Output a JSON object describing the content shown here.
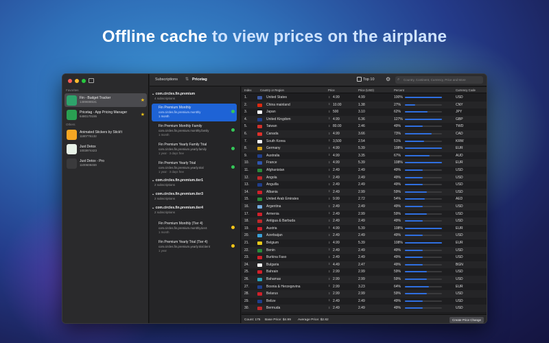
{
  "headline": {
    "part1": "Offline cache",
    "part2": " to view prices on the airplane"
  },
  "sidebar": {
    "favorites_label": "Favorites",
    "others_label": "Others",
    "favorites": [
      {
        "name": "Fin - Budget Tracker",
        "id": "1489698531",
        "icon_color": "#2ea36b"
      },
      {
        "name": "Pricetag - App Pricing Manager",
        "id": "6480170155",
        "icon_color": "#2aa052"
      }
    ],
    "others": [
      {
        "name": "Animated Stickers by Stick!t",
        "id": "1180776132",
        "icon_color": "#f5a623"
      },
      {
        "name": "Just Detox",
        "id": "1003974423",
        "icon_color": "#e8f3e8"
      },
      {
        "name": "Just Detox - Pro",
        "id": "1100608459",
        "icon_color": "#3a3a3c"
      }
    ]
  },
  "toolbar": {
    "subscriptions_label": "Subscriptions",
    "title": "Pricetag",
    "top_label": "Top 10",
    "search_placeholder": "Country, Continent, Currency, Price and More"
  },
  "groups": [
    {
      "title": "com.circles.fin.premium",
      "count": "4 subscriptions"
    },
    {
      "title": "com.circles.fin.premium.tier1",
      "count": "2 subscriptions"
    },
    {
      "title": "com.circles.fin.premium.tier3",
      "count": "2 subscriptions"
    },
    {
      "title": "com.circles.fin.premium.tier4",
      "count": "2 subscriptions"
    }
  ],
  "subscriptions": [
    {
      "name": "Fin Premium Monthly",
      "id": "com.circles.fin.premium.monthly",
      "period": "1 month",
      "status": "#34c759"
    },
    {
      "name": "Fin Premium Monthly Family",
      "id": "com.circles.fin.premium.monthly.family",
      "period": "1 month",
      "status": "#34c759"
    },
    {
      "name": "Fin Premium Yearly Family Trial",
      "id": "com.circles.fin.premium.yearly.family",
      "period": "1 year · 3 days free",
      "status": "#34c759"
    },
    {
      "name": "Fin Premium Yearly Trial",
      "id": "com.circles.fin.premium.yearly.trial",
      "period": "1 year · 3 days free",
      "status": "#34c759"
    },
    {
      "name": "Fin Premium Monthly (Tier 4)",
      "id": "com.circles.fin.premium.monthly.tier4",
      "period": "1 month",
      "status": "#f5c518"
    },
    {
      "name": "Fin Premium Yearly Trial (Tier 4)",
      "id": "com.circles.fin.premium.yearly.trial.tier4",
      "period": "1 year",
      "status": "#f5c518"
    }
  ],
  "table": {
    "headers": {
      "index": "Index",
      "country": "Country or Region",
      "price": "Price",
      "price_usd": "Price (USD)",
      "percent": "Percent",
      "currency": "Currency Code"
    },
    "rows": [
      {
        "i": "1.",
        "country": "United States",
        "price": "4.99",
        "usd": "4.99",
        "pct": "100%",
        "cur": "USD",
        "flag": "#3c5aa6"
      },
      {
        "i": "2.",
        "country": "China mainland",
        "price": "10.00",
        "usd": "1.38",
        "pct": "27%",
        "cur": "CNY",
        "flag": "#de2910"
      },
      {
        "i": "3.",
        "country": "Japan",
        "price": "500",
        "usd": "3.10",
        "pct": "62%",
        "cur": "JPY",
        "flag": "#ffffff"
      },
      {
        "i": "4.",
        "country": "United Kingdom",
        "price": "4.99",
        "usd": "6.36",
        "pct": "127%",
        "cur": "GBP",
        "flag": "#1f3e8c"
      },
      {
        "i": "5.",
        "country": "Taiwan",
        "price": "80.00",
        "usd": "2.46",
        "pct": "49%",
        "cur": "TWD",
        "flag": "#d0302a"
      },
      {
        "i": "6.",
        "country": "Canada",
        "price": "4.99",
        "usd": "3.66",
        "pct": "73%",
        "cur": "CAD",
        "flag": "#e0302a"
      },
      {
        "i": "7.",
        "country": "South Korea",
        "price": "3,500",
        "usd": "2.54",
        "pct": "51%",
        "cur": "KRW",
        "flag": "#f2f2f2"
      },
      {
        "i": "8.",
        "country": "Germany",
        "price": "4.99",
        "usd": "5.39",
        "pct": "108%",
        "cur": "EUR",
        "flag": "#d4a017"
      },
      {
        "i": "9.",
        "country": "Australia",
        "price": "4.99",
        "usd": "3.35",
        "pct": "67%",
        "cur": "AUD",
        "flag": "#1f3e8c"
      },
      {
        "i": "10.",
        "country": "France",
        "price": "4.99",
        "usd": "5.39",
        "pct": "108%",
        "cur": "EUR",
        "flag": "#2f56b0"
      },
      {
        "i": "11.",
        "country": "Afghanistan",
        "price": "2.49",
        "usd": "2.49",
        "pct": "49%",
        "cur": "USD",
        "flag": "#2a8a3a"
      },
      {
        "i": "12.",
        "country": "Angola",
        "price": "2.49",
        "usd": "2.49",
        "pct": "49%",
        "cur": "USD",
        "flag": "#c0282a"
      },
      {
        "i": "13.",
        "country": "Anguilla",
        "price": "2.49",
        "usd": "2.49",
        "pct": "49%",
        "cur": "USD",
        "flag": "#1f3e8c"
      },
      {
        "i": "14.",
        "country": "Albania",
        "price": "2.49",
        "usd": "2.99",
        "pct": "59%",
        "cur": "USD",
        "flag": "#d0202a"
      },
      {
        "i": "15.",
        "country": "United Arab Emirates",
        "price": "9.99",
        "usd": "2.72",
        "pct": "54%",
        "cur": "AED",
        "flag": "#2a8a3a"
      },
      {
        "i": "16.",
        "country": "Argentina",
        "price": "2.49",
        "usd": "2.49",
        "pct": "49%",
        "cur": "USD",
        "flag": "#74acdf"
      },
      {
        "i": "17.",
        "country": "Armenia",
        "price": "2.49",
        "usd": "2.99",
        "pct": "59%",
        "cur": "USD",
        "flag": "#d0202a"
      },
      {
        "i": "18.",
        "country": "Antigua & Barbuda",
        "price": "2.49",
        "usd": "2.49",
        "pct": "49%",
        "cur": "USD",
        "flag": "#c0282a"
      },
      {
        "i": "19.",
        "country": "Austria",
        "price": "4.99",
        "usd": "5.39",
        "pct": "108%",
        "cur": "EUR",
        "flag": "#d0202a"
      },
      {
        "i": "20.",
        "country": "Azerbaijan",
        "price": "2.49",
        "usd": "2.49",
        "pct": "49%",
        "cur": "USD",
        "flag": "#3aa0d8"
      },
      {
        "i": "21.",
        "country": "Belgium",
        "price": "4.99",
        "usd": "5.39",
        "pct": "108%",
        "cur": "EUR",
        "flag": "#e8c81a"
      },
      {
        "i": "22.",
        "country": "Benin",
        "price": "2.49",
        "usd": "2.49",
        "pct": "49%",
        "cur": "USD",
        "flag": "#2a8a3a"
      },
      {
        "i": "23.",
        "country": "Burkina Faso",
        "price": "2.49",
        "usd": "2.49",
        "pct": "49%",
        "cur": "USD",
        "flag": "#d0202a"
      },
      {
        "i": "24.",
        "country": "Bulgaria",
        "price": "4.49",
        "usd": "2.47",
        "pct": "49%",
        "cur": "BGN",
        "flag": "#f2f2f2"
      },
      {
        "i": "25.",
        "country": "Bahrain",
        "price": "2.99",
        "usd": "2.99",
        "pct": "59%",
        "cur": "USD",
        "flag": "#d0202a"
      },
      {
        "i": "26.",
        "country": "Bahamas",
        "price": "2.99",
        "usd": "2.99",
        "pct": "59%",
        "cur": "USD",
        "flag": "#2aa0b8"
      },
      {
        "i": "27.",
        "country": "Bosnia & Herzegovina",
        "price": "2.99",
        "usd": "3.23",
        "pct": "64%",
        "cur": "EUR",
        "flag": "#1f3e8c"
      },
      {
        "i": "28.",
        "country": "Belarus",
        "price": "2.99",
        "usd": "2.99",
        "pct": "59%",
        "cur": "USD",
        "flag": "#d0202a"
      },
      {
        "i": "29.",
        "country": "Belize",
        "price": "2.49",
        "usd": "2.49",
        "pct": "49%",
        "cur": "USD",
        "flag": "#1f3e8c"
      },
      {
        "i": "30.",
        "country": "Bermuda",
        "price": "2.49",
        "usd": "2.49",
        "pct": "49%",
        "cur": "USD",
        "flag": "#c0282a"
      }
    ]
  },
  "footer": {
    "count": "Count: 175",
    "base": "Base Price: $4.99",
    "average": "Average Price: $2.82",
    "button": "Create Price Change"
  },
  "colors": {
    "accent": "#1e63d6",
    "bar": "#2f6fe0"
  }
}
